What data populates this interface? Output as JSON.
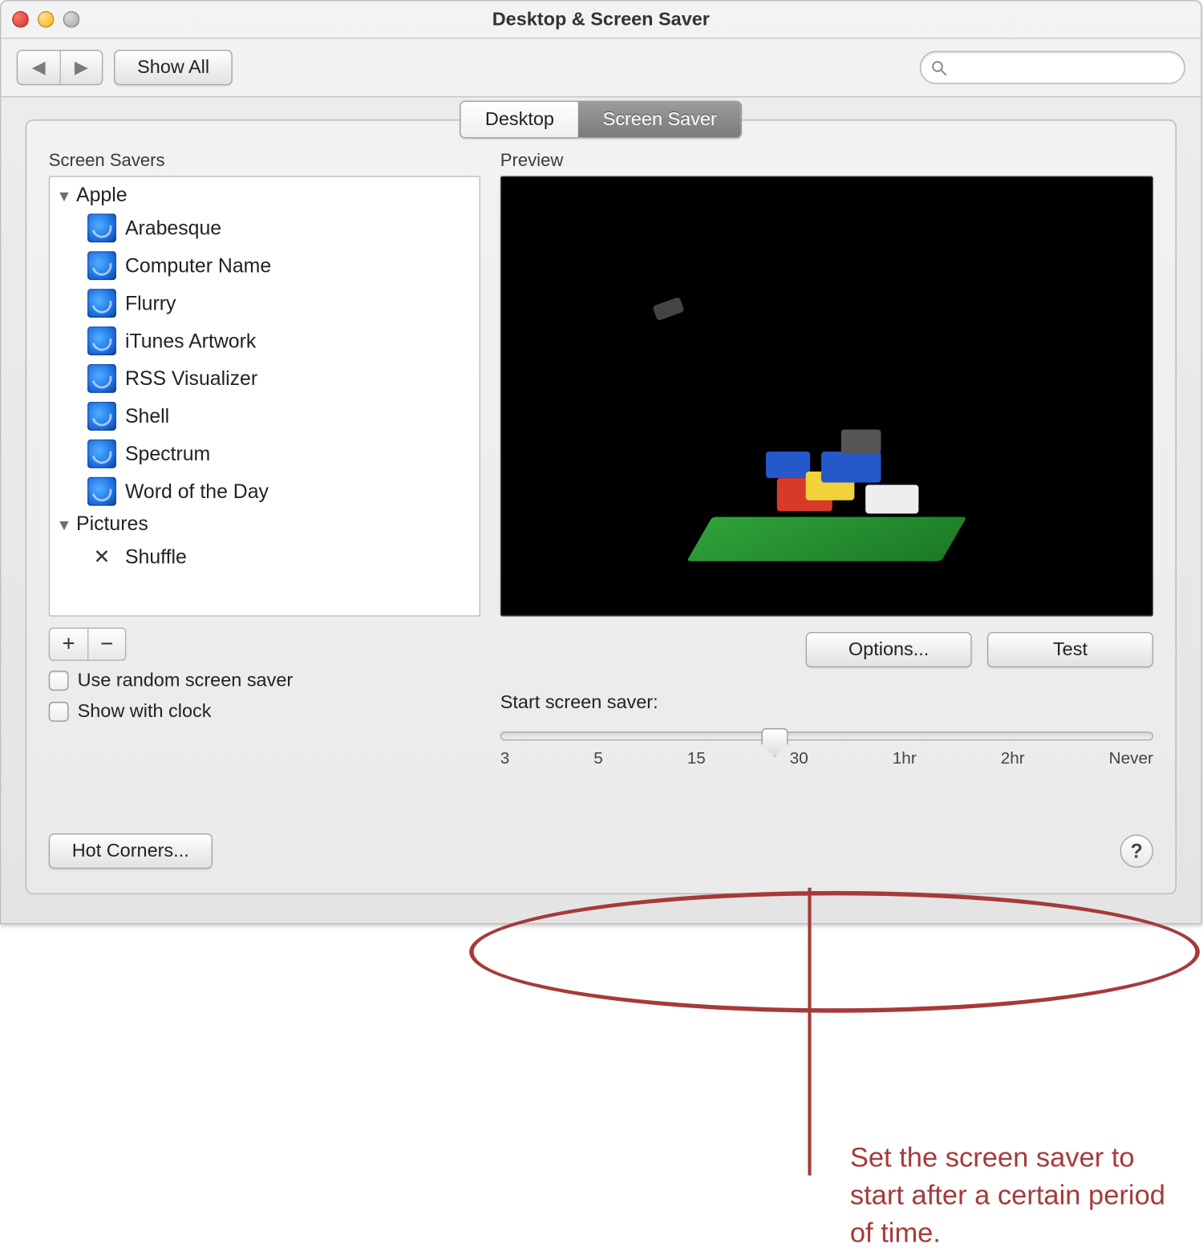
{
  "window": {
    "title": "Desktop & Screen Saver"
  },
  "toolbar": {
    "show_all_label": "Show All",
    "search_placeholder": ""
  },
  "tabs": {
    "desktop": "Desktop",
    "screensaver": "Screen Saver"
  },
  "sidebar": {
    "header": "Screen Savers",
    "groups": [
      {
        "name": "Apple",
        "items": [
          "Arabesque",
          "Computer Name",
          "Flurry",
          "iTunes Artwork",
          "RSS Visualizer",
          "Shell",
          "Spectrum",
          "Word of the Day"
        ]
      },
      {
        "name": "Pictures",
        "items": [
          "Shuffle"
        ]
      }
    ]
  },
  "options": {
    "use_random_label": "Use random screen saver",
    "show_clock_label": "Show with clock"
  },
  "preview": {
    "header": "Preview",
    "options_label": "Options...",
    "test_label": "Test"
  },
  "slider": {
    "label": "Start screen saver:",
    "ticks": [
      "3",
      "5",
      "15",
      "30",
      "1hr",
      "2hr",
      "Never"
    ]
  },
  "footer": {
    "hot_corners_label": "Hot Corners..."
  },
  "annotation": {
    "text": "Set the screen saver to start after a certain period of time."
  }
}
